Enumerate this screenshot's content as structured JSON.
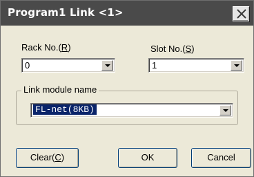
{
  "window": {
    "title": "Program1  Link <1>",
    "close_glyph": "close-icon"
  },
  "rack": {
    "label_text": "Rack No.(",
    "label_mnemonic": "R",
    "label_end": ")",
    "value": "0"
  },
  "slot": {
    "label_text": "Slot No.(",
    "label_mnemonic": "S",
    "label_end": ")",
    "value": "1"
  },
  "link_module": {
    "group_label": "Link module name",
    "value": "FL-net(8KB)"
  },
  "buttons": {
    "clear_text": "Clear(",
    "clear_mnemonic": "C",
    "clear_end": ")",
    "ok": "OK",
    "cancel": "Cancel"
  },
  "colors": {
    "titlebar": "#4a4a4a",
    "dialog_bg": "#ece9d8",
    "selection": "#0a246a"
  }
}
